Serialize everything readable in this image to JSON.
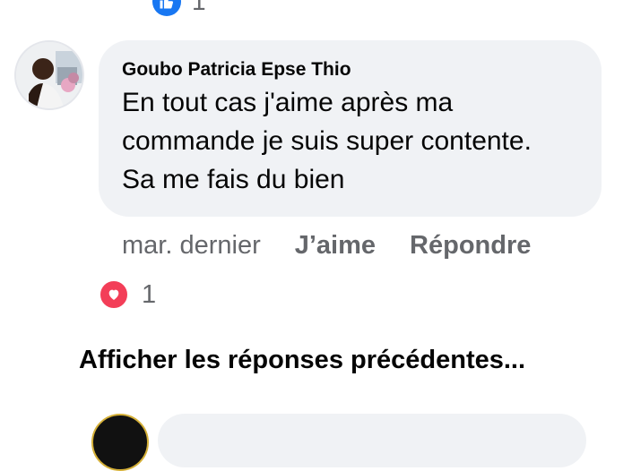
{
  "previous_comment": {
    "like_icon": "thumbs-up-icon",
    "like_count": "1",
    "like_color": "#1877f2"
  },
  "comment": {
    "avatar_icon": "user-avatar",
    "author": "Goubo Patricia Epse Thio",
    "lines": [
      "En tout cas j'aime après ma",
      "commande je suis super contente.",
      "Sa me fais du bien"
    ],
    "timestamp": "mar. dernier",
    "like_label": "J’aime",
    "reply_label": "Répondre",
    "reaction_icon": "heart-icon",
    "reaction_color": "#f33e58",
    "reaction_count": "1"
  },
  "show_previous_replies": "Afficher les réponses précédentes...",
  "bubble_color": "#f0f2f5",
  "secondary_text_color": "#65676b"
}
